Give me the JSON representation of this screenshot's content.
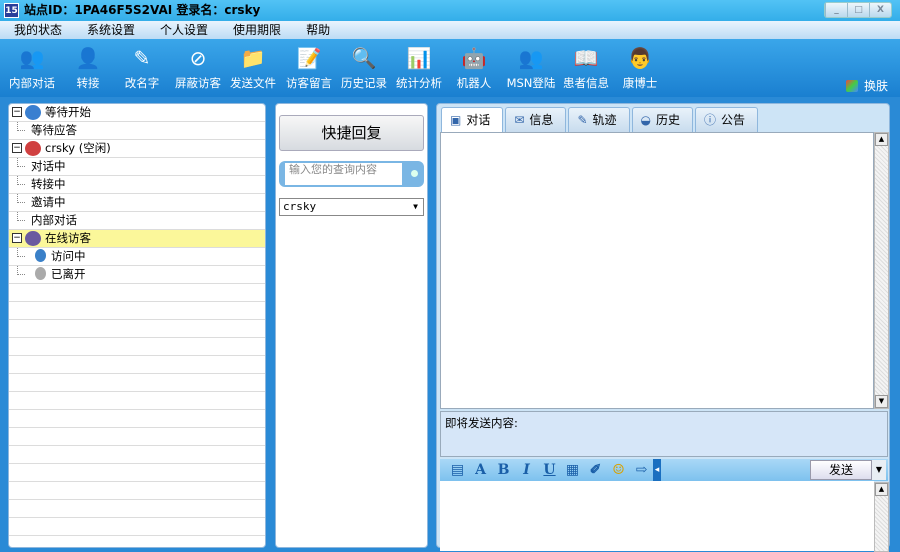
{
  "title": {
    "logo": "15",
    "text": "站点ID：1PA46F5S2VAI  登录名：crsky",
    "buttons": [
      "_",
      "□",
      "X"
    ]
  },
  "menu": [
    "我的状态",
    "系统设置",
    "个人设置",
    "使用期限",
    "帮助"
  ],
  "toolbar": [
    {
      "label": "内部对话",
      "icon": "users-icon",
      "glyph": "👥"
    },
    {
      "label": "转接",
      "icon": "transfer-icon",
      "glyph": "👤"
    },
    {
      "label": "改名字",
      "icon": "rename-icon",
      "glyph": "✎"
    },
    {
      "label": "屏蔽访客",
      "icon": "block-icon",
      "glyph": "⊘"
    },
    {
      "label": "发送文件",
      "icon": "send-file-icon",
      "glyph": "📁"
    },
    {
      "label": "访客留言",
      "icon": "message-icon",
      "glyph": "📝"
    },
    {
      "label": "历史记录",
      "icon": "history-icon",
      "glyph": "🔍"
    },
    {
      "label": "统计分析",
      "icon": "chart-icon",
      "glyph": "📊"
    },
    {
      "label": "机器人",
      "icon": "robot-icon",
      "glyph": "🤖"
    },
    {
      "label": "MSN登陆",
      "icon": "msn-icon",
      "glyph": "👥"
    },
    {
      "label": "患者信息",
      "icon": "book-icon",
      "glyph": "📖"
    },
    {
      "label": "康博士",
      "icon": "doctor-icon",
      "glyph": "👨"
    }
  ],
  "skin_label": "换肤",
  "tree": [
    {
      "label": "等待开始",
      "level": 0,
      "icon": "globe-icon",
      "color": "#3a7fd0"
    },
    {
      "label": "等待应答",
      "level": 1
    },
    {
      "label": "crsky (空闲)",
      "level": 0,
      "icon": "agent-icon",
      "color": "#d04040"
    },
    {
      "label": "对话中",
      "level": 1
    },
    {
      "label": "转接中",
      "level": 1
    },
    {
      "label": "邀请中",
      "level": 1
    },
    {
      "label": "内部对话",
      "level": 1
    },
    {
      "label": "在线访客",
      "level": 0,
      "icon": "visitor-icon",
      "color": "#6a5aa0",
      "selected": true
    },
    {
      "label": "访问中",
      "level": 2,
      "icon": "visiting-icon",
      "color": "#3a80c8"
    },
    {
      "label": "已离开",
      "level": 2,
      "icon": "left-icon",
      "color": "#aaaaaa"
    }
  ],
  "quick": {
    "button": "快捷回复",
    "search_placeholder": "输入您的查询内容",
    "select": "crsky"
  },
  "tabs": [
    {
      "label": "对话",
      "glyph": "▣"
    },
    {
      "label": "信息",
      "glyph": "✉"
    },
    {
      "label": "轨迹",
      "glyph": "✎"
    },
    {
      "label": "历史",
      "glyph": "◒"
    },
    {
      "label": "公告",
      "glyph": "ⓘ"
    }
  ],
  "compose": {
    "label": "即将发送内容:",
    "send": "发送",
    "tools": [
      {
        "name": "screenshot-icon",
        "glyph": "▤"
      },
      {
        "name": "font-color-icon",
        "glyph": "A"
      },
      {
        "name": "bold-icon",
        "glyph": "B"
      },
      {
        "name": "italic-icon",
        "glyph": "I"
      },
      {
        "name": "underline-icon",
        "glyph": "U"
      },
      {
        "name": "color-grid-icon",
        "glyph": "▦"
      },
      {
        "name": "attach-icon",
        "glyph": "✐"
      },
      {
        "name": "emoji-icon",
        "glyph": "☺"
      },
      {
        "name": "forward-icon",
        "glyph": "⇨"
      }
    ]
  }
}
